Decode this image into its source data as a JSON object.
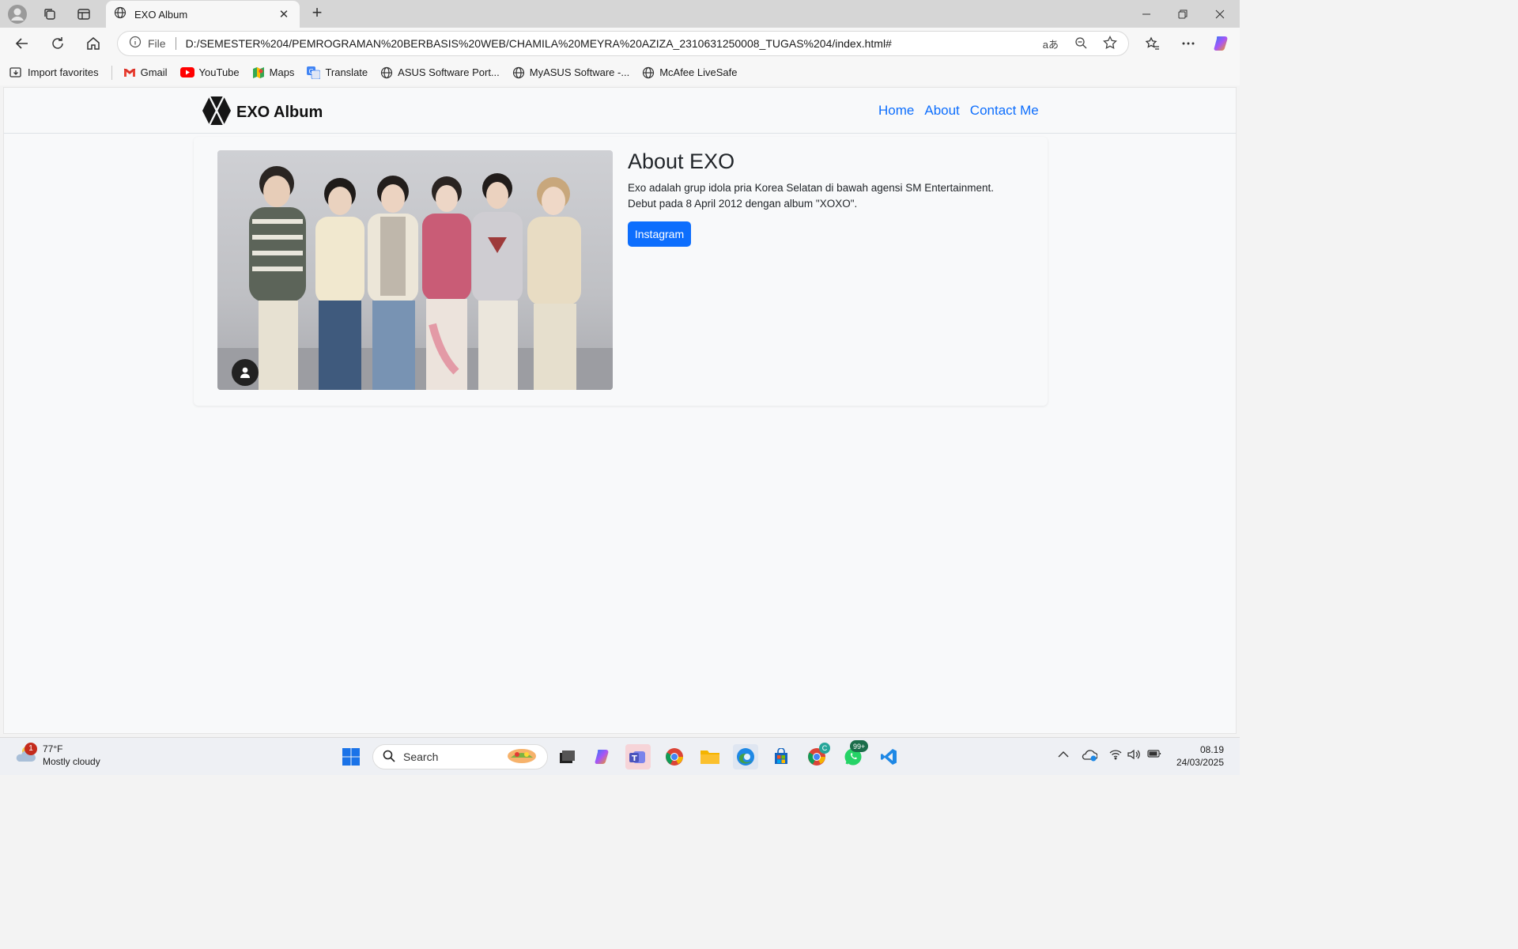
{
  "browser": {
    "tab_title": "EXO Album",
    "url_scheme_label": "File",
    "url": "D:/SEMESTER%204/PEMROGRAMAN%20BERBASIS%20WEB/CHAMILA%20MEYRA%20AZIZA_2310631250008_TUGAS%204/index.html#",
    "translate_label": "aあ"
  },
  "favorites": [
    {
      "label": "Import favorites",
      "icon": "import-icon"
    },
    {
      "label": "Gmail",
      "icon": "gmail-icon"
    },
    {
      "label": "YouTube",
      "icon": "youtube-icon"
    },
    {
      "label": "Maps",
      "icon": "maps-icon"
    },
    {
      "label": "Translate",
      "icon": "translate-icon"
    },
    {
      "label": "ASUS Software Port...",
      "icon": "globe-icon"
    },
    {
      "label": "MyASUS Software -...",
      "icon": "globe-icon"
    },
    {
      "label": "McAfee LiveSafe",
      "icon": "globe-icon"
    }
  ],
  "site": {
    "brand": "EXO Album",
    "nav": [
      "Home",
      "About",
      "Contact Me"
    ],
    "about_title": "About EXO",
    "about_text": "Exo adalah grup idola pria Korea Selatan di bawah agensi SM Entertainment. Debut pada 8 April 2012 dengan album \"XOXO\".",
    "button_label": "Instagram"
  },
  "taskbar": {
    "weather_temp": "77°F",
    "weather_desc": "Mostly cloudy",
    "weather_badge": "1",
    "search_label": "Search",
    "whatsapp_badge": "99+",
    "chrome_badge": "C",
    "time": "08.19",
    "date": "24/03/2025"
  },
  "colors": {
    "link": "#0d6efd",
    "button": "#0d6efd",
    "page_bg": "#f8f9fa"
  }
}
